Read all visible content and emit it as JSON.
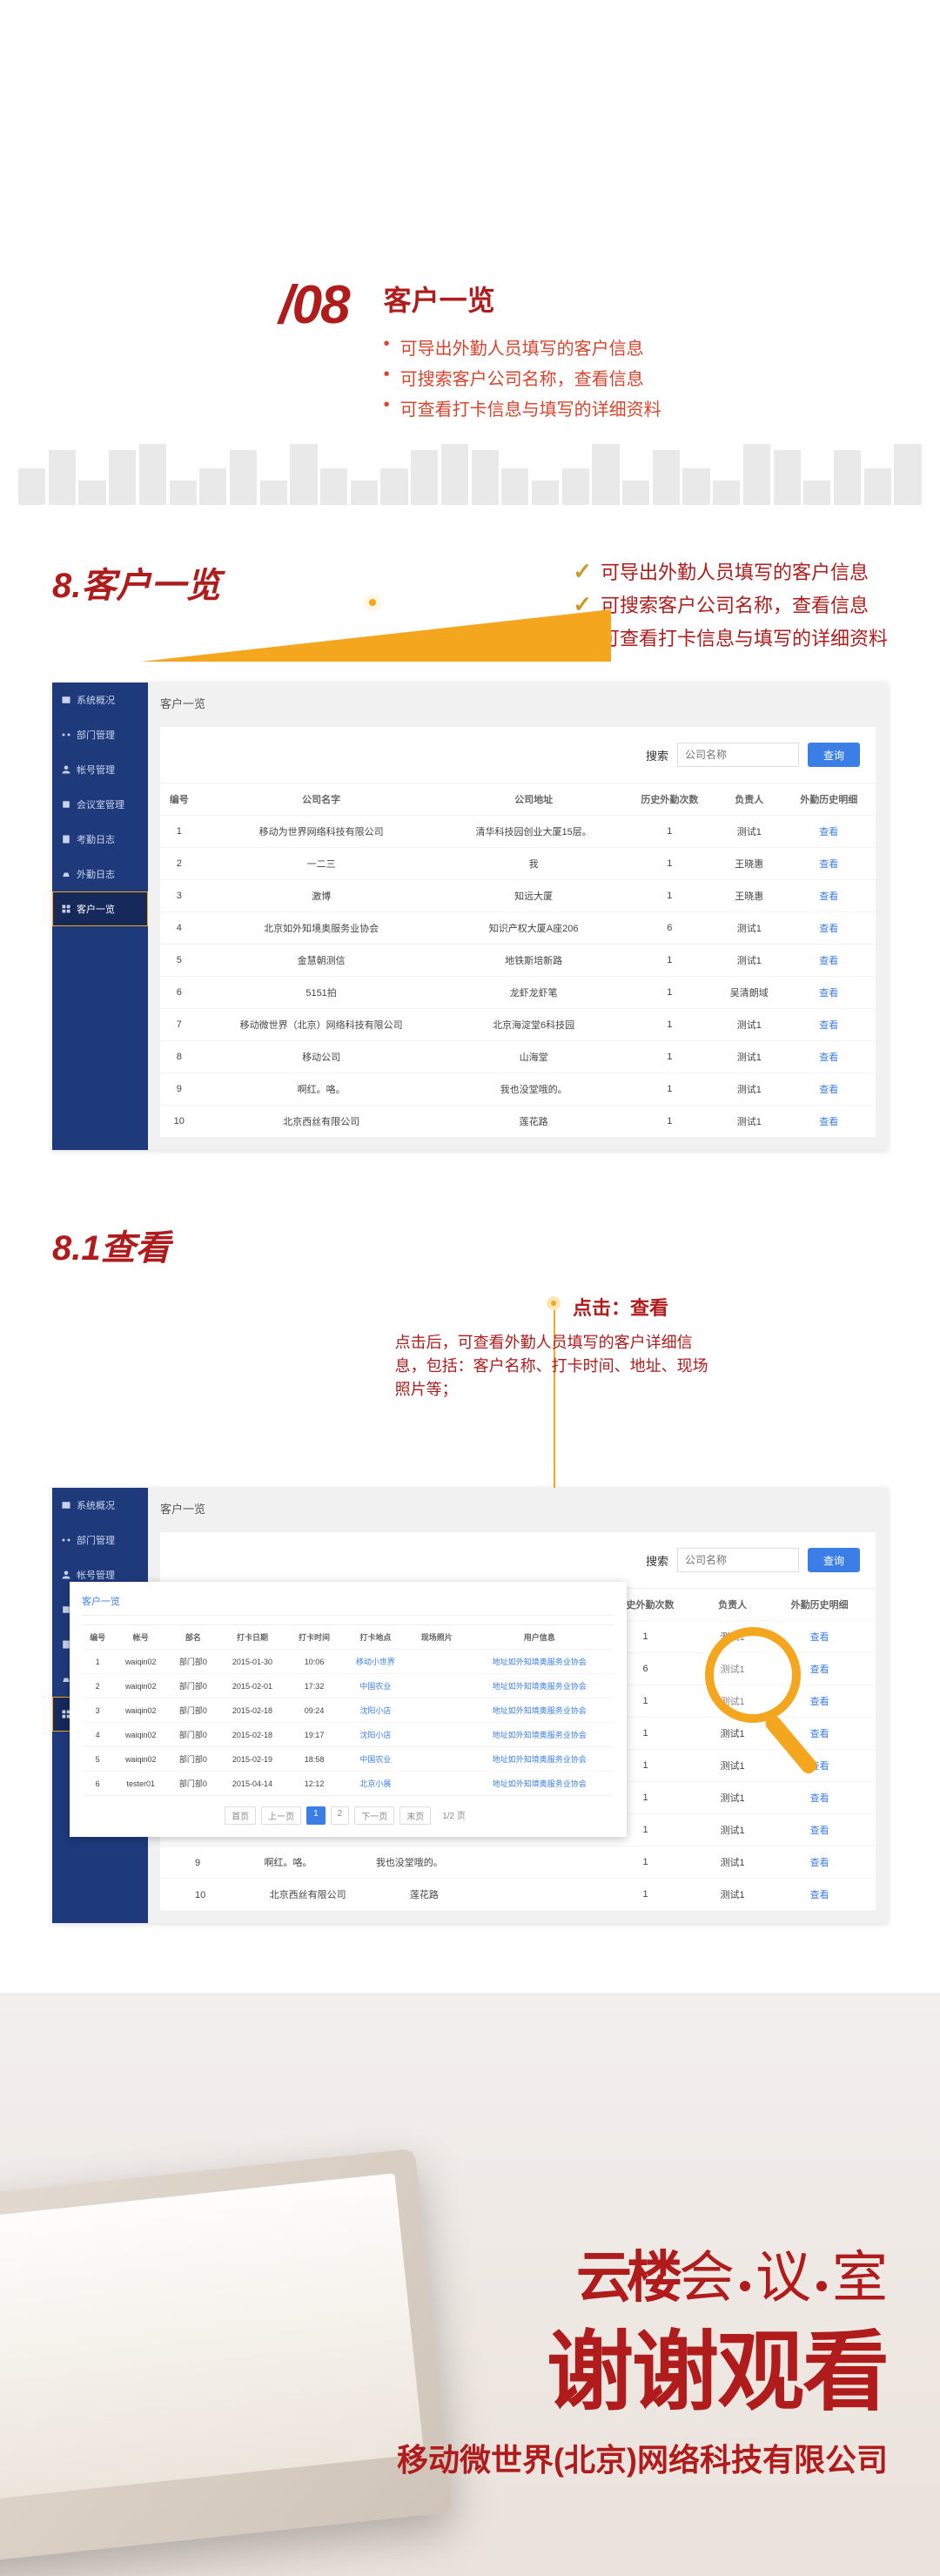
{
  "hero": {
    "number": "/08",
    "title": "客户一览",
    "bullets": [
      "可导出外勤人员填写的客户信息",
      "可搜索客户公司名称，查看信息",
      "可查看打卡信息与填写的详细资料"
    ]
  },
  "section8": {
    "heading": "8.客户一览",
    "checks": [
      "可导出外勤人员填写的客户信息",
      "可搜索客户公司名称，查看信息",
      "可查看打卡信息与填写的详细资料"
    ]
  },
  "sidebar": [
    "系统概况",
    "部门管理",
    "帐号管理",
    "会议室管理",
    "考勤日志",
    "外勤日志",
    "客户一览"
  ],
  "app": {
    "breadcrumb": "客户一览",
    "search_label": "搜索",
    "search_placeholder": "公司名称",
    "search_button": "查询",
    "columns": [
      "编号",
      "公司名字",
      "公司地址",
      "历史外勤次数",
      "负责人",
      "外勤历史明细"
    ],
    "view_label": "查看",
    "rows": [
      {
        "id": "1",
        "name": "移动为世界网络科技有限公司",
        "addr": "清华科技园创业大厦15层。",
        "cnt": "1",
        "owner": "测试1"
      },
      {
        "id": "2",
        "name": "一二三",
        "addr": "我",
        "cnt": "1",
        "owner": "王晓惠"
      },
      {
        "id": "3",
        "name": "激博",
        "addr": "知远大厦",
        "cnt": "1",
        "owner": "王晓惠"
      },
      {
        "id": "4",
        "name": "北京如外知境奥服务业协会",
        "addr": "知识产权大厦A座206",
        "cnt": "6",
        "owner": "测试1"
      },
      {
        "id": "5",
        "name": "金慧朝测信",
        "addr": "地铁斯培新路",
        "cnt": "1",
        "owner": "测试1"
      },
      {
        "id": "6",
        "name": "5151拍",
        "addr": "龙虾龙虾笔",
        "cnt": "1",
        "owner": "吴清朗域"
      },
      {
        "id": "7",
        "name": "移动微世界（北京）网络科技有限公司",
        "addr": "北京海淀堂6科技园",
        "cnt": "1",
        "owner": "测试1"
      },
      {
        "id": "8",
        "name": "移动公司",
        "addr": "山海堂",
        "cnt": "1",
        "owner": "测试1"
      },
      {
        "id": "9",
        "name": "啊红。咯。",
        "addr": "我也没堂哦的。",
        "cnt": "1",
        "owner": "测试1"
      },
      {
        "id": "10",
        "name": "北京西丝有限公司",
        "addr": "莲花路",
        "cnt": "1",
        "owner": "测试1"
      }
    ]
  },
  "section81": {
    "heading": "8.1查看",
    "pin_title": "点击：查看",
    "pin_body": "点击后，可查看外勤人员填写的客户详细信息，包括：客户名称、打卡时间、地址、现场照片等；"
  },
  "overlay": {
    "title": "客户一览",
    "columns": [
      "编号",
      "帐号",
      "部名",
      "打卡日期",
      "打卡时间",
      "打卡地点",
      "现场照片",
      "用户信息"
    ],
    "rows": [
      {
        "id": "1",
        "acc": "waiqin02",
        "dep": "部门部0",
        "date": "2015-01-30",
        "time": "10:06",
        "loc": "移动小世界",
        "thumb": "",
        "link": "地址如外知境奥服务业协会"
      },
      {
        "id": "2",
        "acc": "waiqin02",
        "dep": "部门部0",
        "date": "2015-02-01",
        "time": "17:32",
        "loc": "中国农业",
        "thumb": "",
        "link": "地址如外知境奥服务业协会"
      },
      {
        "id": "3",
        "acc": "waiqin02",
        "dep": "部门部0",
        "date": "2015-02-18",
        "time": "09:24",
        "loc": "沈阳小店",
        "thumb": "",
        "link": "地址如外知境奥服务业协会"
      },
      {
        "id": "4",
        "acc": "waiqin02",
        "dep": "部门部0",
        "date": "2015-02-18",
        "time": "19:17",
        "loc": "沈阳小店",
        "thumb": "",
        "link": "地址如外知境奥服务业协会"
      },
      {
        "id": "5",
        "acc": "waiqin02",
        "dep": "部门部0",
        "date": "2015-02-19",
        "time": "18:58",
        "loc": "中国农业",
        "thumb": "",
        "link": "地址如外知境奥服务业协会"
      },
      {
        "id": "6",
        "acc": "tester01",
        "dep": "部门部0",
        "date": "2015-04-14",
        "time": "12:12",
        "loc": "北京小展",
        "thumb": "",
        "link": "地址如外知境奥服务业协会"
      }
    ],
    "pager": {
      "first": "首页",
      "prev": "上一页",
      "pages": [
        "1",
        "2"
      ],
      "next": "下一页",
      "last": "末页",
      "pos": "1/2 页"
    }
  },
  "app2_extra_rows": [
    {
      "id": "8",
      "name": "移动公司",
      "addr": "山海堂",
      "cnt": "1",
      "owner": "测试1"
    },
    {
      "id": "9",
      "name": "啊红。咯。",
      "addr": "我也没堂哦的。",
      "cnt": "1",
      "owner": "测试1"
    },
    {
      "id": "10",
      "name": "北京西丝有限公司",
      "addr": "莲花路",
      "cnt": "1",
      "owner": "测试1"
    }
  ],
  "app2_short_rows": [
    {
      "cnt": "1",
      "owner": "测试1"
    },
    {
      "cnt": "6",
      "owner": "测试1"
    },
    {
      "cnt": "1",
      "owner": "测试1"
    },
    {
      "cnt": "1",
      "owner": "测试1"
    },
    {
      "cnt": "1",
      "owner": "测试1"
    },
    {
      "cnt": "1",
      "owner": "测试1"
    }
  ],
  "footer": {
    "brand_a": "云楼",
    "brand_b": "会",
    "brand_c": "议",
    "brand_d": "室",
    "thanks": "谢谢观看",
    "company": "移动微世界(北京)网络科技有限公司"
  }
}
